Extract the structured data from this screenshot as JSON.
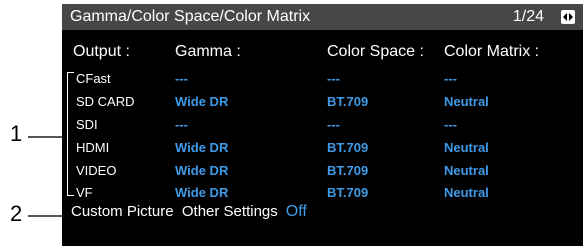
{
  "title_bar": {
    "title": "Gamma/Color Space/Color Matrix",
    "page": "1/24"
  },
  "headers": {
    "output": "Output :",
    "gamma": "Gamma :",
    "color_space": "Color Space :",
    "color_matrix": "Color Matrix :"
  },
  "rows": [
    {
      "output": "CFast",
      "gamma": "---",
      "color_space": "---",
      "color_matrix": "---"
    },
    {
      "output": "SD CARD",
      "gamma": "Wide DR",
      "color_space": "BT.709",
      "color_matrix": "Neutral"
    },
    {
      "output": "SDI",
      "gamma": "---",
      "color_space": "---",
      "color_matrix": "---"
    },
    {
      "output": "HDMI",
      "gamma": "Wide DR",
      "color_space": "BT.709",
      "color_matrix": "Neutral"
    },
    {
      "output": "VIDEO",
      "gamma": "Wide DR",
      "color_space": "BT.709",
      "color_matrix": "Neutral"
    },
    {
      "output": "VF",
      "gamma": "Wide DR",
      "color_space": "BT.709",
      "color_matrix": "Neutral"
    }
  ],
  "custom_picture": {
    "label": "Custom Picture  Other Settings",
    "value": "Off"
  },
  "callouts": [
    "1",
    "2"
  ],
  "colors": {
    "value": "#3f9be8",
    "title_bar": "#474747",
    "background": "#000000"
  },
  "icons": {
    "page_switch": "page-switch-icon"
  }
}
